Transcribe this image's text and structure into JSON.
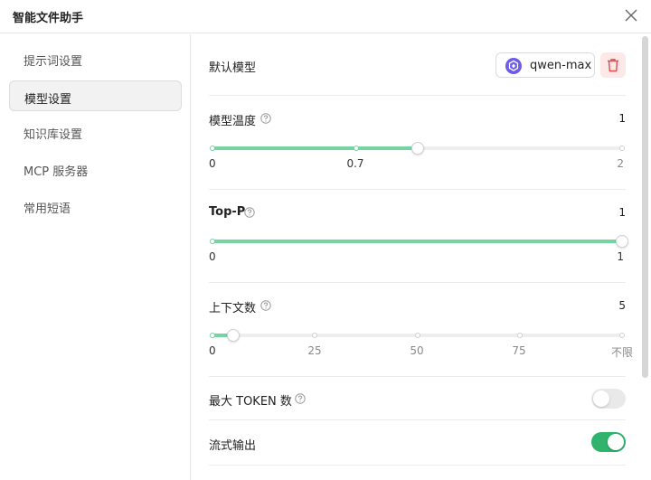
{
  "window": {
    "title": "智能文件助手"
  },
  "sidebar": {
    "items": [
      {
        "label": "提示词设置",
        "active": false
      },
      {
        "label": "模型设置",
        "active": true
      },
      {
        "label": "知识库设置",
        "active": false
      },
      {
        "label": "MCP 服务器",
        "active": false
      },
      {
        "label": "常用短语",
        "active": false
      }
    ]
  },
  "default_model": {
    "label": "默认模型",
    "model_name": "qwen-max",
    "delete_icon": "trash-icon",
    "model_icon": "qwen-logo-icon"
  },
  "temperature": {
    "label": "模型温度",
    "value": "1",
    "min": 0,
    "max": 2,
    "current": 1,
    "ticks": [
      "0",
      "0.7",
      "2"
    ]
  },
  "top_p": {
    "label": "Top-P",
    "value": "1",
    "min": 0,
    "max": 1,
    "current": 1,
    "ticks": [
      "0",
      "1"
    ]
  },
  "context": {
    "label": "上下文数",
    "value": "5",
    "min": 0,
    "max": 100,
    "current": 5,
    "ticks": [
      "0",
      "25",
      "50",
      "75",
      "不限"
    ]
  },
  "max_token": {
    "label": "最大 TOKEN 数",
    "enabled": false
  },
  "streaming": {
    "label": "流式输出",
    "enabled": true
  },
  "colors": {
    "accent": "#2fb36d",
    "slider_fill": "#74d4a2",
    "danger": "#e5484d",
    "model_logo": "#6c5ce7"
  }
}
